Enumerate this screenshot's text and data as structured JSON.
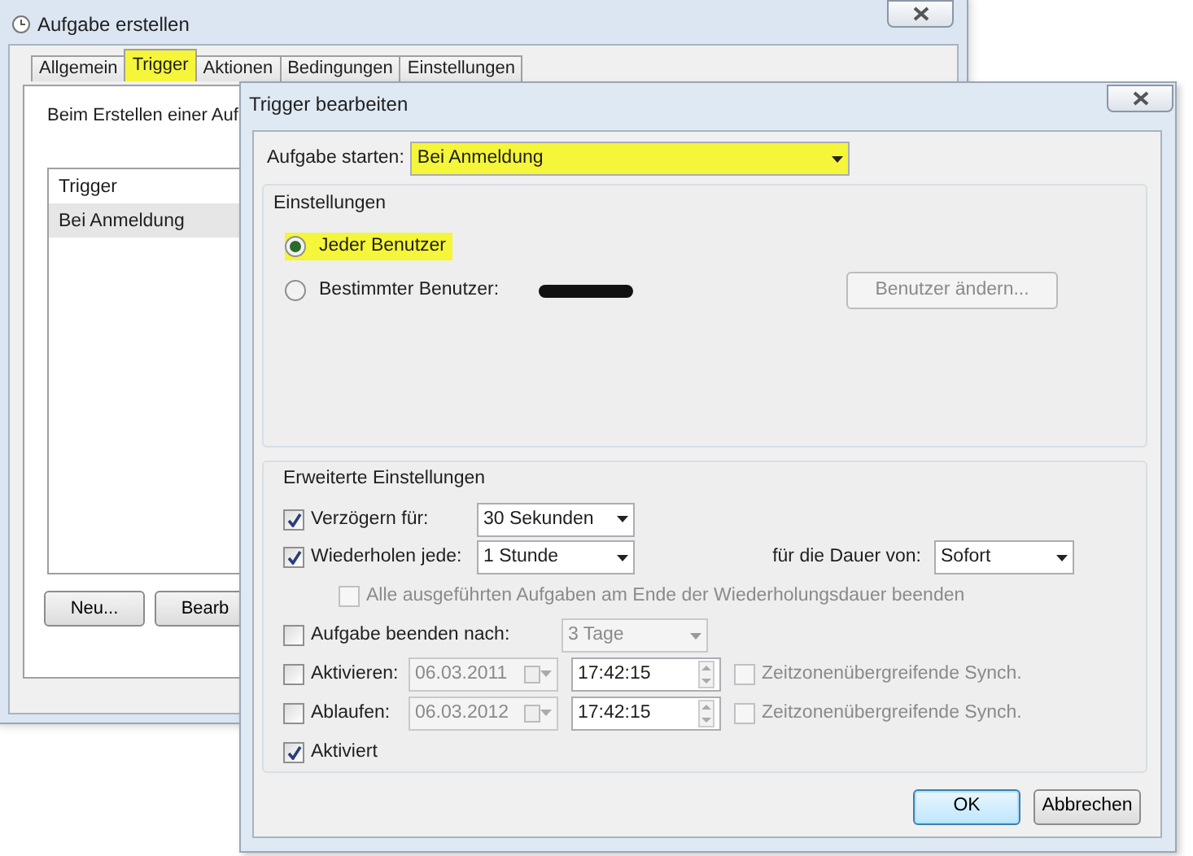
{
  "back_window": {
    "title": "Aufgabe erstellen",
    "tabs": [
      {
        "label": "Allgemein",
        "selected": false,
        "highlighted": false
      },
      {
        "label": "Trigger",
        "selected": true,
        "highlighted": true
      },
      {
        "label": "Aktionen",
        "selected": false,
        "highlighted": false
      },
      {
        "label": "Bedingungen",
        "selected": false,
        "highlighted": false
      },
      {
        "label": "Einstellungen",
        "selected": false,
        "highlighted": false
      }
    ],
    "description": "Beim Erstellen einer Auf",
    "trigger_list": {
      "column": "Trigger",
      "rows": [
        {
          "label": "Bei Anmeldung",
          "selected": true
        }
      ]
    },
    "buttons": [
      "Neu...",
      "Bearb"
    ]
  },
  "dialog": {
    "title": "Trigger bearbeiten",
    "start": {
      "label": "Aufgabe starten:",
      "value": "Bei Anmeldung",
      "highlighted": true
    },
    "settings": {
      "title": "Einstellungen",
      "options": [
        {
          "label": "Jeder Benutzer",
          "selected": true,
          "highlighted": true,
          "redacted": false
        },
        {
          "label": "Bestimmter Benutzer:",
          "selected": false,
          "highlighted": false,
          "redacted": true
        }
      ],
      "change_user": {
        "label": "Benutzer ändern...",
        "disabled": true
      }
    },
    "advanced": {
      "title": "Erweiterte Einstellungen",
      "rows": [
        {
          "kind": "dropdown",
          "label": "Verzögern für:",
          "checked": true,
          "value": "30 Sekunden"
        },
        {
          "kind": "repeat",
          "label": "Wiederholen jede:",
          "checked": true,
          "value": "1 Stunde",
          "duration_label": "für die Dauer von:",
          "duration_value": "Sofort"
        },
        {
          "kind": "subcheck",
          "label": "Alle ausgeführten Aufgaben am Ende der Wiederholungsdauer beenden",
          "checked": false,
          "disabled": true
        },
        {
          "kind": "dropdown",
          "label": "Aufgabe beenden nach:",
          "checked": false,
          "value": "3 Tage"
        },
        {
          "kind": "datetime",
          "label": "Aktivieren:",
          "checked": false,
          "date": "06.03.2011",
          "time": "17:42:15",
          "sync_label": "Zeitzonenübergreifende Synch.",
          "sync_checked": false
        },
        {
          "kind": "datetime",
          "label": "Ablaufen:",
          "checked": false,
          "date": "06.03.2012",
          "time": "17:42:15",
          "sync_label": "Zeitzonenübergreifende Synch.",
          "sync_checked": false
        },
        {
          "kind": "check",
          "label": "Aktiviert",
          "checked": true
        }
      ]
    },
    "buttons": [
      {
        "label": "OK",
        "default": true
      },
      {
        "label": "Abbrechen",
        "default": false
      }
    ]
  }
}
